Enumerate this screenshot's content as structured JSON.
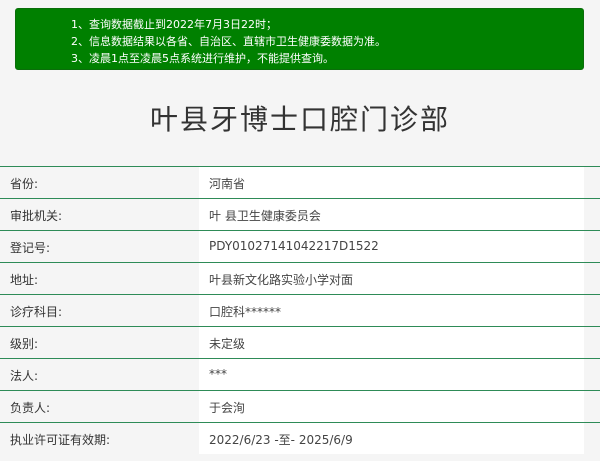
{
  "notice": {
    "lines": [
      {
        "num": "1、",
        "text": "查询数据截止到2022年7月3日22时；"
      },
      {
        "num": "2、",
        "text": "信息数据结果以各省、自治区、直辖市卫生健康委数据为准。"
      },
      {
        "num": "3、",
        "text": "凌晨1点至凌晨5点系统进行维护，不能提供查询。"
      }
    ]
  },
  "title": "叶县牙博士口腔门诊部",
  "rows": [
    {
      "label": "省份:",
      "value": "河南省"
    },
    {
      "label": "审批机关:",
      "value": "叶 县卫生健康委员会"
    },
    {
      "label": "登记号:",
      "value": "PDY01027141042217D1522"
    },
    {
      "label": "地址:",
      "value": "叶县新文化路实验小学对面"
    },
    {
      "label": "诊疗科目:",
      "value": "口腔科******"
    },
    {
      "label": "级别:",
      "value": "未定级"
    },
    {
      "label": "法人:",
      "value": "***"
    },
    {
      "label": "负责人:",
      "value": "于会洵"
    },
    {
      "label": "执业许可证有效期:",
      "value": "2022/6/23 -至- 2025/6/9"
    }
  ],
  "colors": {
    "notice_bg": "#008000",
    "row_border": "#2e8b57",
    "page_bg": "#f5f5f5"
  }
}
